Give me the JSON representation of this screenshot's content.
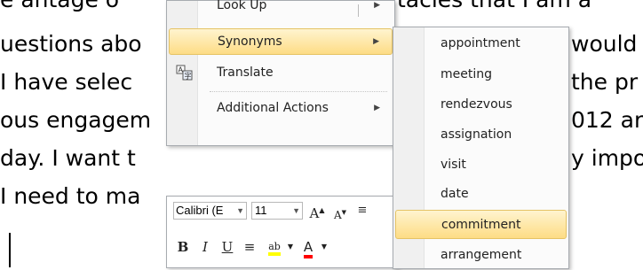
{
  "document": {
    "lines_left": [
      "uestions abo",
      "I have selec",
      "ous engagem",
      "day.  I want t",
      "I need to ma"
    ],
    "lines_right": [
      "would",
      "the pr",
      "012 ar",
      "y impo"
    ],
    "top_left": "e antage o",
    "top_right": "itacles that I am a"
  },
  "context_menu": {
    "items": [
      {
        "label": "Look Up",
        "has_submenu": true
      },
      {
        "label": "Synonyms",
        "has_submenu": true,
        "highlighted": true
      },
      {
        "label": "Translate",
        "has_submenu": false,
        "icon": "translate-icon"
      },
      {
        "label": "Additional Actions",
        "has_submenu": true
      }
    ]
  },
  "synonyms_submenu": {
    "items": [
      "appointment",
      "meeting",
      "rendezvous",
      "assignation",
      "visit",
      "date",
      "commitment",
      "arrangement"
    ],
    "highlighted": "commitment"
  },
  "mini_toolbar": {
    "font_name": "Calibri (E",
    "font_size": "11",
    "grow_font": "A",
    "shrink_font": "A",
    "bold": "B",
    "italic": "I",
    "underline": "U",
    "highlight_color": "#ffff00",
    "font_color": "#ff0000",
    "font_color_letter": "A"
  }
}
